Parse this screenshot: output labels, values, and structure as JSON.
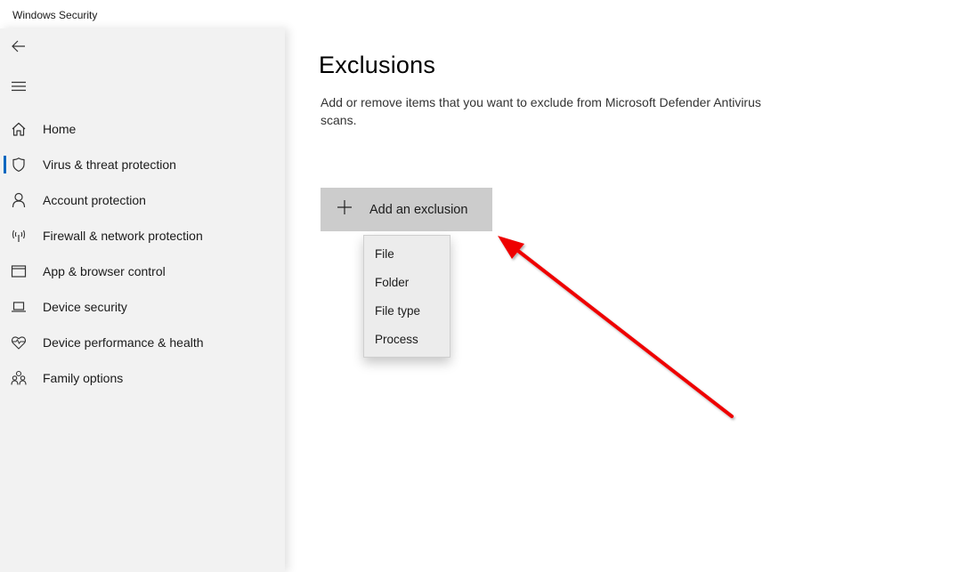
{
  "window": {
    "title": "Windows Security"
  },
  "sidebar": {
    "back_icon": "back-arrow-icon",
    "menu_icon": "hamburger-menu-icon",
    "items": [
      {
        "label": "Home",
        "icon": "home-icon",
        "active": false
      },
      {
        "label": "Virus & threat protection",
        "icon": "shield-icon",
        "active": true
      },
      {
        "label": "Account protection",
        "icon": "person-icon",
        "active": false
      },
      {
        "label": "Firewall & network protection",
        "icon": "antenna-icon",
        "active": false
      },
      {
        "label": "App & browser control",
        "icon": "browser-window-icon",
        "active": false
      },
      {
        "label": "Device security",
        "icon": "laptop-icon",
        "active": false
      },
      {
        "label": "Device performance & health",
        "icon": "heart-pulse-icon",
        "active": false
      },
      {
        "label": "Family options",
        "icon": "family-icon",
        "active": false
      }
    ],
    "accent_color": "#0067c0"
  },
  "main": {
    "title": "Exclusions",
    "description": "Add or remove items that you want to exclude from Microsoft Defender Antivirus scans.",
    "add_button": {
      "label": "Add an exclusion",
      "icon": "plus-icon"
    },
    "dropdown": {
      "options": [
        "File",
        "Folder",
        "File type",
        "Process"
      ]
    }
  },
  "annotation": {
    "type": "arrow",
    "color": "#ee0000",
    "points_to": "add-exclusion-button"
  }
}
